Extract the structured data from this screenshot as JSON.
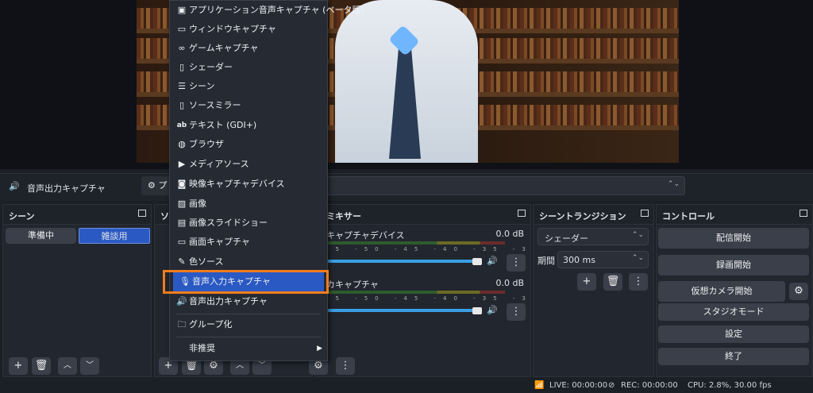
{
  "menu": {
    "items": [
      {
        "label": "アプリケーション音声キャプチャ (ベータ版)",
        "icon": "app-audio-icon"
      },
      {
        "label": "ウィンドウキャプチャ",
        "icon": "window-icon"
      },
      {
        "label": "ゲームキャプチャ",
        "icon": "gamepad-icon"
      },
      {
        "label": "シェーダー",
        "icon": "file-icon"
      },
      {
        "label": "シーン",
        "icon": "list-icon"
      },
      {
        "label": "ソースミラー",
        "icon": "file-icon"
      },
      {
        "label": "テキスト (GDI+)",
        "icon": "text-icon"
      },
      {
        "label": "ブラウザ",
        "icon": "globe-icon"
      },
      {
        "label": "メディアソース",
        "icon": "play-icon"
      },
      {
        "label": "映像キャプチャデバイス",
        "icon": "camera-icon"
      },
      {
        "label": "画像",
        "icon": "image-icon"
      },
      {
        "label": "画像スライドショー",
        "icon": "slideshow-icon"
      },
      {
        "label": "画面キャプチャ",
        "icon": "monitor-icon"
      },
      {
        "label": "色ソース",
        "icon": "brush-icon"
      },
      {
        "label": "音声入力キャプチャ",
        "icon": "microphone-icon",
        "selected": true
      },
      {
        "label": "音声出力キャプチャ",
        "icon": "speaker-icon"
      }
    ],
    "group_label": "グループ化",
    "deprecated_label": "非推奨"
  },
  "source_bar": {
    "selected_source": "音声出力キャプチャ",
    "properties_label": "プ"
  },
  "scenes": {
    "title": "シーン",
    "items": [
      "準備中",
      "雑談用"
    ],
    "active": "雑談用"
  },
  "sources": {
    "title": "ソ"
  },
  "mixer": {
    "title": "ミキサー",
    "channels": [
      {
        "name": "キャプチャデバイス",
        "db": "0.0 dB",
        "volume_percent": 95
      },
      {
        "name": "カキャプチャ",
        "db": "0.0 dB",
        "volume_percent": 95
      }
    ],
    "scale": "-5 -50 -45 -40 -35 -30 -25 -20 -15 -10 -5 0"
  },
  "transitions": {
    "title": "シーントランジション",
    "selected": "シェーダー",
    "duration_label": "期間",
    "duration_value": "300 ms"
  },
  "controls": {
    "title": "コントロール",
    "buttons": [
      "配信開始",
      "録画開始",
      "仮想カメラ開始",
      "スタジオモード",
      "設定",
      "終了"
    ]
  },
  "status": {
    "live": "LIVE: 00:00:00",
    "rec": "REC: 00:00:00",
    "cpu": "CPU: 2.8%, 30.00 fps"
  },
  "colors": {
    "accent": "#2b59c3",
    "highlight": "#f07c1e",
    "meter_green": "#2e5b2e"
  }
}
